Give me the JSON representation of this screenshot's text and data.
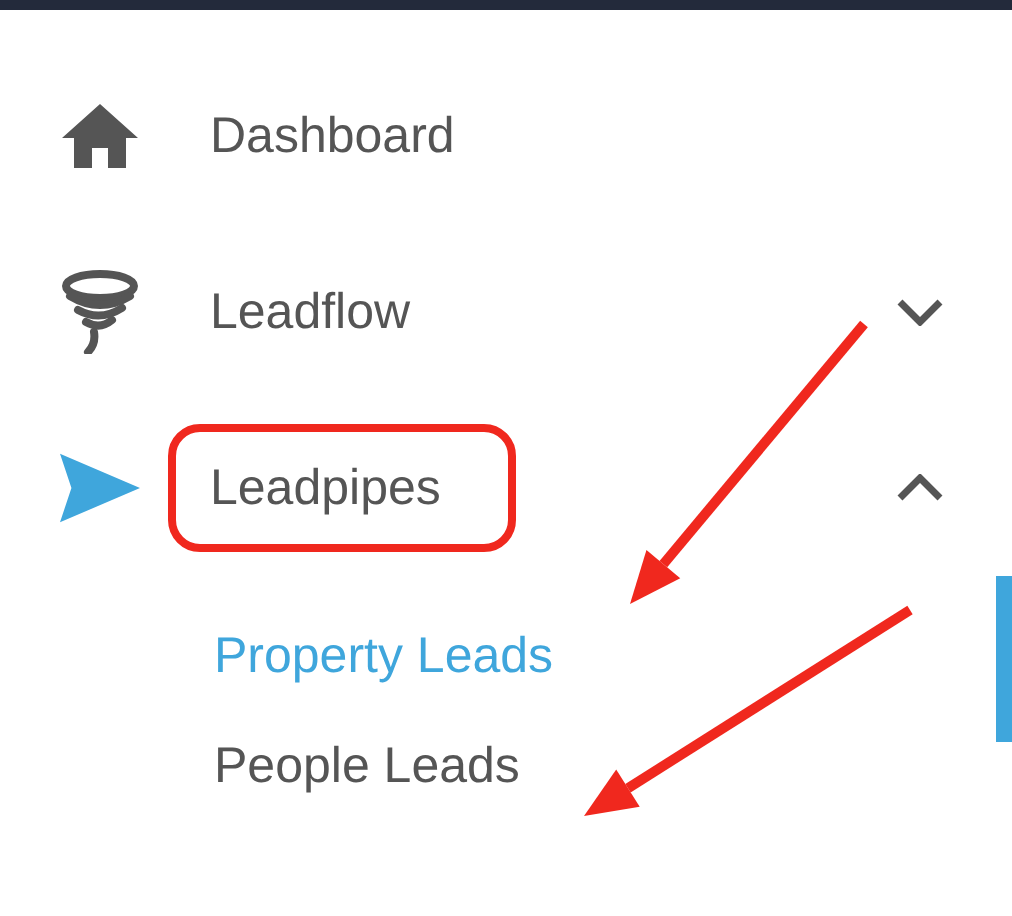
{
  "menu": [
    {
      "label": "Dashboard",
      "kind": "link",
      "active": false
    },
    {
      "label": "Leadflow",
      "kind": "group",
      "active": false,
      "expanded": false
    },
    {
      "label": "Leadpipes",
      "kind": "group",
      "active": true,
      "expanded": true,
      "children": [
        {
          "label": "Property Leads",
          "selected": true
        },
        {
          "label": "People Leads",
          "selected": false
        }
      ]
    }
  ],
  "annotations": [
    {
      "kind": "highlight"
    },
    {
      "kind": "arrow"
    },
    {
      "kind": "arrow"
    }
  ]
}
